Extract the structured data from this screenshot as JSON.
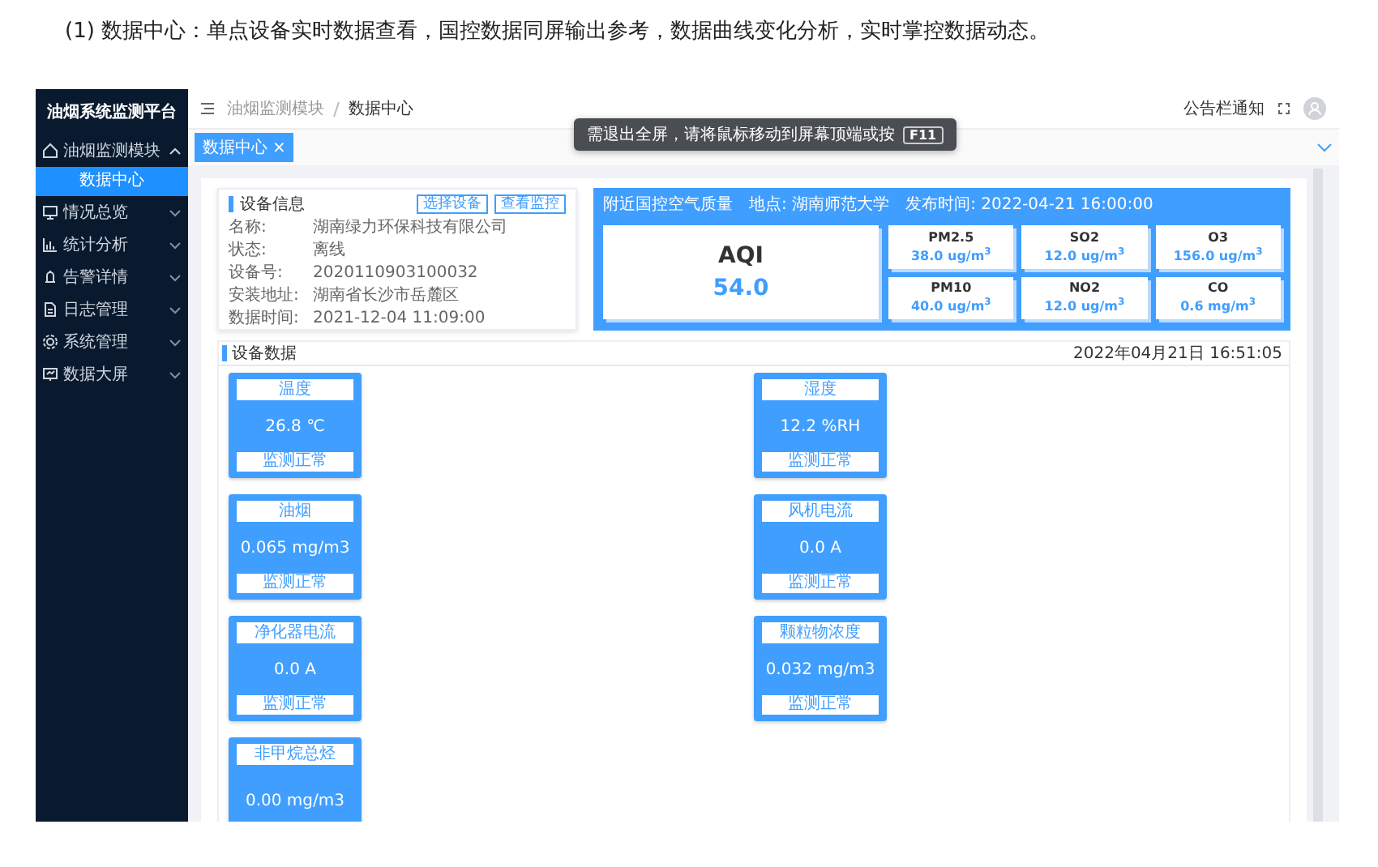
{
  "caption": "(1) 数据中心：单点设备实时数据查看，国控数据同屏输出参考，数据曲线变化分析，实时掌控数据动态。",
  "sidebar": {
    "title": "油烟系统监测平台",
    "items": [
      {
        "label": "油烟监测模块",
        "expanded": true,
        "children": [
          {
            "label": "数据中心",
            "selected": true
          }
        ]
      },
      {
        "label": "情况总览",
        "expanded": false
      },
      {
        "label": "统计分析",
        "expanded": false
      },
      {
        "label": "告警详情",
        "expanded": false
      },
      {
        "label": "日志管理",
        "expanded": false
      },
      {
        "label": "系统管理",
        "expanded": false
      },
      {
        "label": "数据大屏",
        "expanded": false
      }
    ]
  },
  "header": {
    "breadcrumb": [
      "油烟监测模块",
      "数据中心"
    ],
    "notice": "公告栏通知"
  },
  "tabs": [
    {
      "label": "数据中心",
      "close": "×",
      "selected": true
    }
  ],
  "toast": {
    "text": "需退出全屏，请将鼠标移动到屏幕顶端或按",
    "key": "F11"
  },
  "device_info": {
    "title": "设备信息",
    "buttons": [
      "选择设备",
      "查看监控"
    ],
    "fields": [
      {
        "label": "名称:",
        "value": "湖南绿力环保科技有限公司"
      },
      {
        "label": "状态:",
        "value": "离线"
      },
      {
        "label": "设备号:",
        "value": "2020110903100032"
      },
      {
        "label": "安装地址:",
        "value": "湖南省长沙市岳麓区"
      },
      {
        "label": "数据时间:",
        "value": "2021-12-04 11:09:00"
      }
    ]
  },
  "air_quality": {
    "title": "附近国控空气质量",
    "location": "地点: 湖南师范大学",
    "published": "发布时间: 2022-04-21 16:00:00",
    "aqi": {
      "label": "AQI",
      "value": "54.0"
    },
    "pollutants": [
      {
        "name": "PM2.5",
        "value": "38.0 ug/m$^{3}$"
      },
      {
        "name": "SO2",
        "value": "12.0 ug/m$^{3}$"
      },
      {
        "name": "O3",
        "value": "156.0 ug/m$^{3}$"
      },
      {
        "name": "PM10",
        "value": "40.0 ug/m$^{3}$"
      },
      {
        "name": "NO2",
        "value": "12.0 ug/m$^{3}$"
      },
      {
        "name": "CO",
        "value": "0.6 mg/m$^{3}$"
      }
    ]
  },
  "device_data": {
    "title": "设备数据",
    "timestamp": "2022年04月21日 16:51:05",
    "sensors": [
      {
        "name": "温度",
        "value": "26.8 ℃",
        "status": "监测正常"
      },
      {
        "name": "湿度",
        "value": "12.2 %RH",
        "status": "监测正常"
      },
      {
        "name": "油烟",
        "value": "0.065 mg/m3",
        "status": "监测正常"
      },
      {
        "name": "风机电流",
        "value": "0.0 A",
        "status": "监测正常"
      },
      {
        "name": "净化器电流",
        "value": "0.0 A",
        "status": "监测正常"
      },
      {
        "name": "颗粒物浓度",
        "value": "0.032 mg/m3",
        "status": "监测正常"
      },
      {
        "name": "非甲烷总烃",
        "value": "0.00 mg/m3"
      }
    ]
  }
}
